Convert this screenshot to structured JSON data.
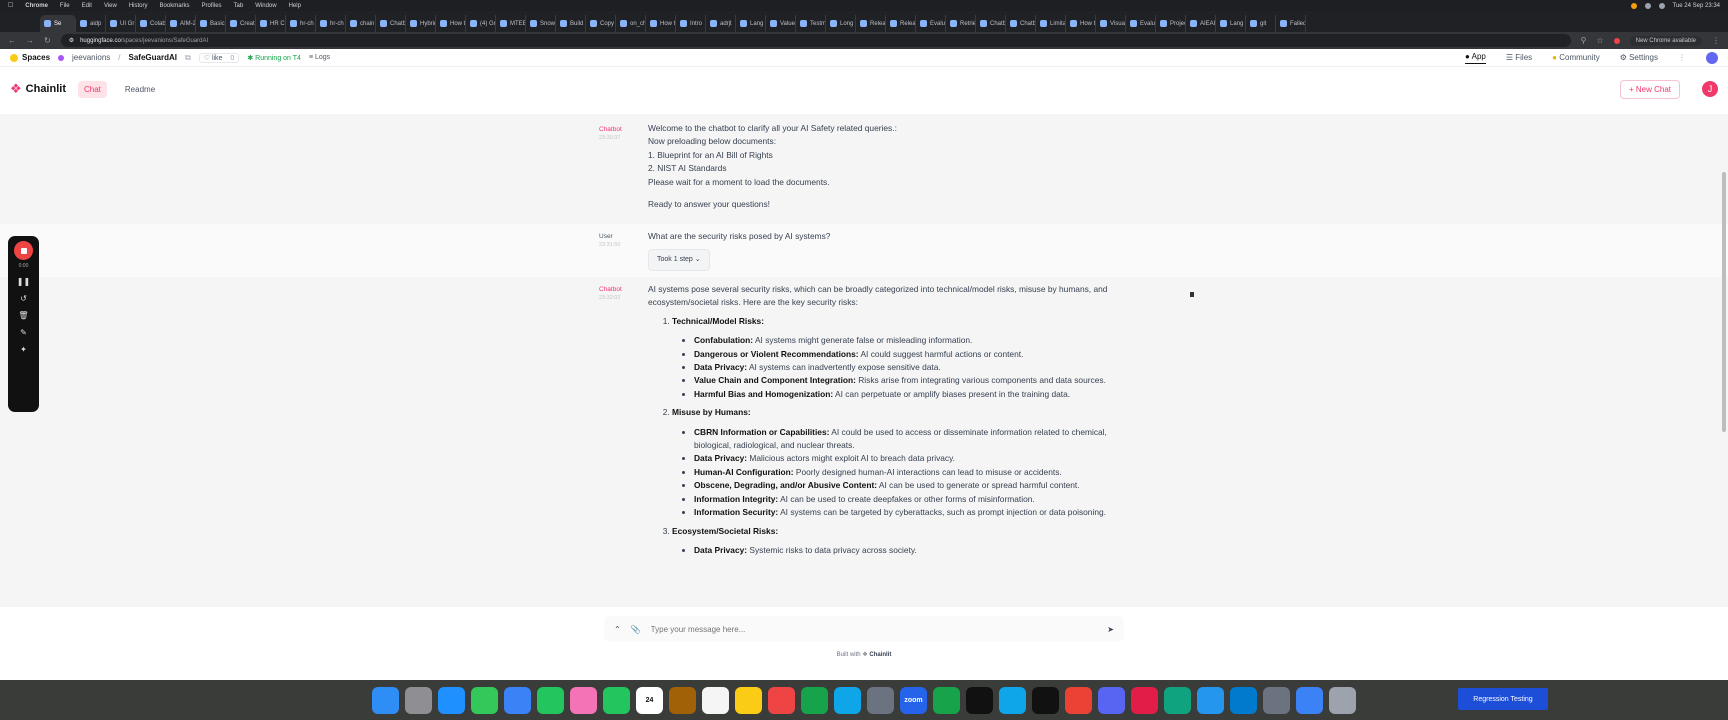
{
  "menubar": {
    "app": "Chrome",
    "items": [
      "File",
      "Edit",
      "View",
      "History",
      "Bookmarks",
      "Profiles",
      "Tab",
      "Window",
      "Help"
    ],
    "clock": "Tue 24 Sep 23:34"
  },
  "tabs": [
    "Se",
    "aidp",
    "UI Gr",
    "Colab",
    "AIM-2",
    "Basic",
    "Creat",
    "HR Ch",
    "hr-ch",
    "hr-ch",
    "chain",
    "Chatb",
    "Hybrid",
    "How t",
    "(4) Gr",
    "MTEB",
    "Snow",
    "Build",
    "Copy",
    "on_ch",
    "How t",
    "Intro",
    "adrjt",
    "Lang",
    "Value",
    "Testm",
    "Long",
    "Relea",
    "Relea",
    "Evalu",
    "Retrie",
    "Chatb",
    "Chatb",
    "Limita",
    "How t",
    "Visual",
    "Evalua",
    "Projec",
    "AIEAI",
    "Lang",
    "git",
    "Failed"
  ],
  "address": {
    "host": "huggingface.co",
    "path": "/spaces/jeevanions/SafeGuardAI",
    "chrome_available": "New Chrome available"
  },
  "hf": {
    "spaces_label": "Spaces",
    "owner": "jeevanions",
    "space_name": "SafeGuardAI",
    "like_label": "like",
    "like_count": "0",
    "running": "Running on T4",
    "logs": "Logs",
    "nav": [
      "App",
      "Files",
      "Community",
      "Settings"
    ]
  },
  "chainlit": {
    "logo": "Chainlit",
    "tabs": [
      "Chat",
      "Readme"
    ],
    "new_chat": "New Chat",
    "avatar": "J"
  },
  "messages": {
    "m1": {
      "author": "Chatbot",
      "time": "23:30:37",
      "lines": [
        "Welcome to the chatbot to clarify all your AI Safety related queries.:",
        "Now preloading below documents:",
        "1. Blueprint for an AI Bill of Rights",
        "2. NIST AI Standards",
        "Please wait for a moment to load the documents."
      ],
      "ready": "Ready to answer your questions!"
    },
    "m2": {
      "author": "User",
      "time": "23:31:50",
      "text": "What are the security risks posed by AI systems?",
      "steps": "Took 1 step"
    },
    "m3": {
      "author": "Chatbot",
      "time": "23:32:02",
      "intro": "AI systems pose several security risks, which can be broadly categorized into technical/model risks, misuse by humans, and ecosystem/societal risks. Here are the key security risks:",
      "sec1": {
        "title": "Technical/Model Risks:",
        "items": [
          {
            "term": "Confabulation:",
            "desc": " AI systems might generate false or misleading information."
          },
          {
            "term": "Dangerous or Violent Recommendations:",
            "desc": " AI could suggest harmful actions or content."
          },
          {
            "term": "Data Privacy:",
            "desc": " AI systems can inadvertently expose sensitive data."
          },
          {
            "term": "Value Chain and Component Integration:",
            "desc": " Risks arise from integrating various components and data sources."
          },
          {
            "term": "Harmful Bias and Homogenization:",
            "desc": " AI can perpetuate or amplify biases present in the training data."
          }
        ]
      },
      "sec2": {
        "title": "Misuse by Humans:",
        "items": [
          {
            "term": "CBRN Information or Capabilities:",
            "desc": " AI could be used to access or disseminate information related to chemical, biological, radiological, and nuclear threats."
          },
          {
            "term": "Data Privacy:",
            "desc": " Malicious actors might exploit AI to breach data privacy."
          },
          {
            "term": "Human-AI Configuration:",
            "desc": " Poorly designed human-AI interactions can lead to misuse or accidents."
          },
          {
            "term": "Obscene, Degrading, and/or Abusive Content:",
            "desc": " AI can be used to generate or spread harmful content."
          },
          {
            "term": "Information Integrity:",
            "desc": " AI can be used to create deepfakes or other forms of misinformation."
          },
          {
            "term": "Information Security:",
            "desc": " AI systems can be targeted by cyberattacks, such as prompt injection or data poisoning."
          }
        ]
      },
      "sec3": {
        "title": "Ecosystem/Societal Risks:",
        "items": [
          {
            "term": "Data Privacy:",
            "desc": " Systemic risks to data privacy across society."
          }
        ]
      }
    }
  },
  "composer": {
    "placeholder": "Type your message here..."
  },
  "footer": {
    "built_with": "Built with",
    "brand": "Chainlit"
  },
  "recorder": {
    "time": "0:00"
  },
  "dock": {
    "icons": [
      "finder-icon",
      "launchpad-icon",
      "safari-icon",
      "messages-icon",
      "mail-icon",
      "maps-icon",
      "photos-icon",
      "facetime-icon",
      "calendar-icon",
      "contacts-icon",
      "reminders-icon",
      "notes-icon",
      "news-icon",
      "numbers-icon",
      "appstore-icon",
      "settings-icon",
      "zoom-icon",
      "excel-icon",
      "notion-icon",
      "edge-icon",
      "terminal-icon",
      "chrome-icon",
      "discord-icon",
      "slack-icon",
      "chatgpt-icon",
      "docker-icon",
      "vscode-icon",
      "preview-icon",
      "folder-icon",
      "trash-icon"
    ],
    "calendar_day": "24",
    "zoom_label": "zoom",
    "task_label": "Regression Testing"
  },
  "colors": {
    "accent": "#f0386b",
    "running": "#16a34a"
  }
}
